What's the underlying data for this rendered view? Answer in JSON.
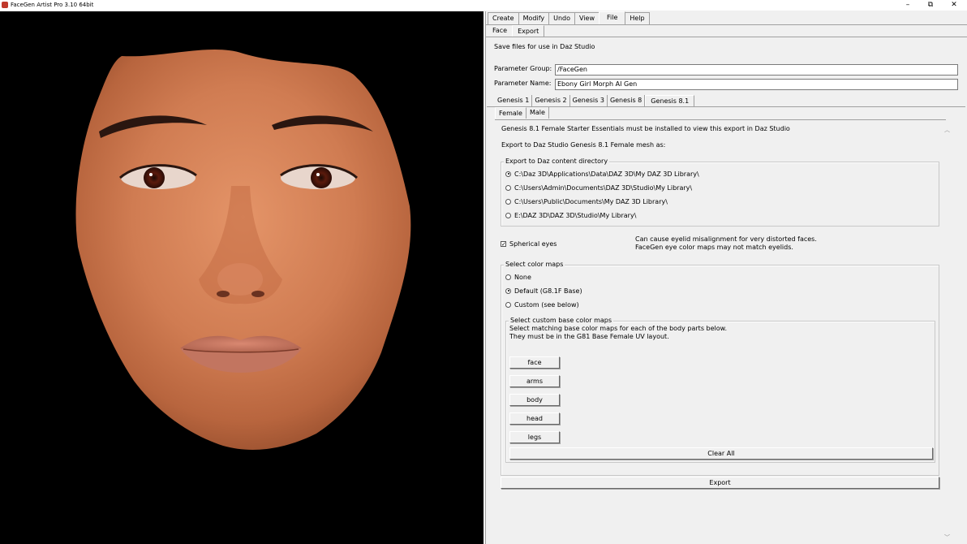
{
  "window": {
    "title": "FaceGen Artist Pro 3.10 64bit",
    "minimize": "–",
    "restore": "⧉",
    "close": "✕"
  },
  "menu": {
    "tabs": [
      "Create",
      "Modify",
      "Undo",
      "View",
      "File",
      "Help"
    ],
    "active": "File"
  },
  "subtabs": {
    "items": [
      "Face",
      "Export"
    ],
    "active": "Export"
  },
  "export": {
    "heading": "Save files for use in Daz Studio",
    "param_group_label": "Parameter Group:",
    "param_group_value": "/FaceGen",
    "param_name_label": "Parameter Name:",
    "param_name_value": "Ebony Girl Morph AI Gen",
    "genesis_tabs": [
      "Genesis 1",
      "Genesis 2",
      "Genesis 3",
      "Genesis 8",
      "Genesis 8.1"
    ],
    "genesis_active": "Genesis 8.1",
    "gender_tabs": [
      "Female",
      "Male"
    ],
    "gender_active": "Female",
    "notice": "Genesis 8.1 Female Starter Essentials must be installed to view this export in Daz Studio",
    "mesh_text": "Export to Daz Studio Genesis 8.1 Female mesh as:",
    "dir_group_title": "Export to Daz content directory",
    "dirs": [
      "C:\\Daz 3D\\Applications\\Data\\DAZ 3D\\My DAZ 3D Library\\",
      "C:\\Users\\Admin\\Documents\\DAZ 3D\\Studio\\My Library\\",
      "C:\\Users\\Public\\Documents\\My DAZ 3D Library\\",
      "E:\\DAZ 3D\\DAZ 3D\\Studio\\My Library\\"
    ],
    "dir_selected": 0,
    "spherical_eyes_label": "Spherical eyes",
    "spherical_eyes_checked": true,
    "spherical_note_1": "Can cause eyelid misalignment for very distorted faces.",
    "spherical_note_2": "FaceGen eye color maps may not match eyelids.",
    "color_group_title": "Select color maps",
    "color_options": [
      "None",
      "Default (G8.1F Base)",
      "Custom (see below)"
    ],
    "color_selected": 1,
    "custom_group_title": "Select custom base color maps",
    "custom_text_1": "Select matching base color maps for each of the body parts below.",
    "custom_text_2": "They must be in the G81 Base Female UV layout.",
    "body_parts": [
      "face",
      "arms",
      "body",
      "head",
      "legs"
    ],
    "clear_all": "Clear All",
    "export_button": "Export"
  },
  "colors": {
    "panel_bg": "#f0f0f0",
    "viewport_bg": "#000000",
    "skin": "#d4825a"
  }
}
